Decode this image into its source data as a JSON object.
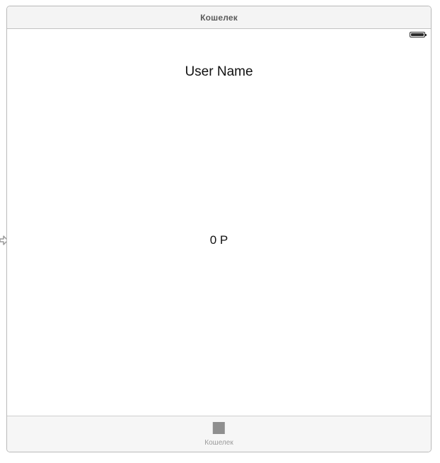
{
  "scene": {
    "title": "Кошелек"
  },
  "status_bar": {
    "battery_icon": "battery-icon"
  },
  "main": {
    "user_name": "User Name",
    "balance": "0 Р"
  },
  "tab_bar": {
    "items": [
      {
        "label": "Кошелек",
        "icon": "square-icon",
        "selected": true
      }
    ]
  },
  "colors": {
    "border": "#b9b9b9",
    "header_bg": "#f4f4f4",
    "tab_bar_bg": "#f6f6f6",
    "tab_icon": "#8f8f8f",
    "text": "#111111"
  }
}
